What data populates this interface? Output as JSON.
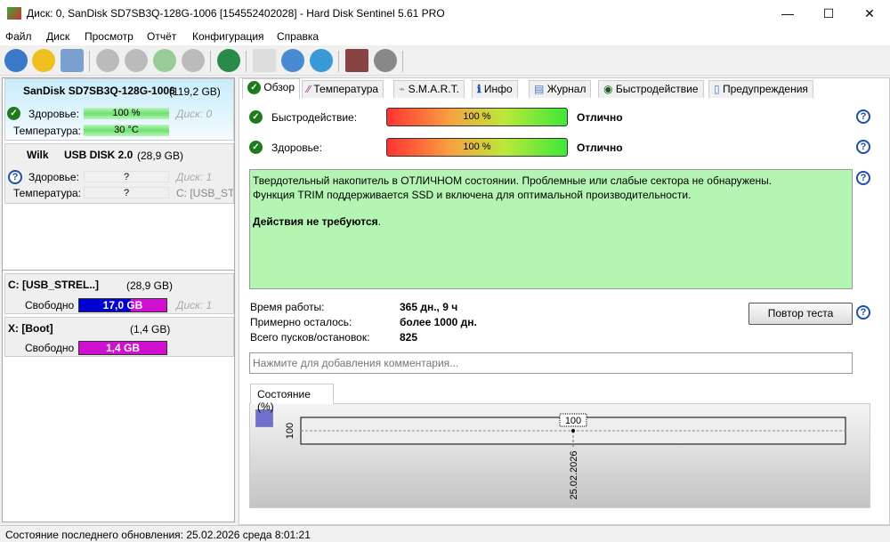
{
  "window": {
    "title": "Диск: 0, SanDisk SD7SB3Q-128G-1006 [154552402028]  -  Hard Disk Sentinel 5.61 PRO",
    "minimize": "—",
    "maximize": "☐",
    "close": "✕"
  },
  "menu": [
    "Файл",
    "Диск",
    "Просмотр",
    "Отчёт",
    "Конфигурация",
    "Справка"
  ],
  "toolbar": [
    "refresh-icon",
    "alert-icon",
    "disk-icon",
    "disk-1-icon",
    "disk-2-icon",
    "disk-check-icon",
    "disk-search-icon",
    "web-icon",
    "report-icon",
    "sync-icon",
    "network-icon",
    "monitor-icon",
    "speaker-icon",
    "help-icon",
    "info-icon"
  ],
  "disks": [
    {
      "name": "SanDisk SD7SB3Q-128G-1006",
      "size": "(119,2 GB)",
      "health_label": "Здоровье:",
      "health": "100 %",
      "disk": "Диск: 0",
      "temp_label": "Температура:",
      "temp": "30 °C"
    },
    {
      "vendor": "Wilk",
      "name": "USB DISK 2.0",
      "size": "(28,9 GB)",
      "health_label": "Здоровье:",
      "health": "?",
      "disk": "Диск: 1",
      "temp_label": "Температура:",
      "temp": "?",
      "vol": "C: [USB_STR"
    }
  ],
  "partitions": [
    {
      "name": "C: [USB_STREL..]",
      "size": "(28,9 GB)",
      "free_label": "Свободно",
      "free": "17,0 GB",
      "free_fraction": 0.59,
      "disk": "Диск: 1"
    },
    {
      "name": "X: [Boot]",
      "size": "(1,4 GB)",
      "free_label": "Свободно",
      "free": "1,4 GB",
      "free_fraction": 1.0
    }
  ],
  "tabs": [
    "Обзор",
    "Температура",
    "S.M.A.R.T.",
    "Инфо",
    "Журнал",
    "Быстродействие",
    "Предупреждения"
  ],
  "overview": {
    "perf_label": "Быстродействие:",
    "perf": "100 %",
    "perf_status": "Отлично",
    "health_label": "Здоровье:",
    "health": "100 %",
    "health_status": "Отлично",
    "desc1": "Твердотельный накопитель в ОТЛИЧНОМ состоянии. Проблемные или слабые сектора не обнаружены.",
    "desc2": "Функция TRIM поддерживается SSD и включена для оптимальной производительности.",
    "action": "Действия не требуются",
    "uptime_label": "Время работы:",
    "uptime": "365 дн., 9 ч",
    "remain_label": "Примерно осталось:",
    "remain": "более 1000 дн.",
    "starts_label": "Всего пусков/остановок:",
    "starts": "825",
    "retest": "Повтор теста",
    "comment_placeholder": "Нажмите для добавления комментария..."
  },
  "chart_data": {
    "type": "line",
    "tab": "Состояние (%)",
    "x": [
      "25.02.2026"
    ],
    "values": [
      100
    ],
    "ylabel_tick": "100",
    "point_label": "100"
  },
  "status": "Состояние последнего обновления: 25.02.2026 среда 8:01:21",
  "colors": {
    "green_box": "#b4f5b4",
    "accent": "#1d4fa8",
    "free_blue": "#0000d0",
    "free_magenta": "#d010d0"
  }
}
